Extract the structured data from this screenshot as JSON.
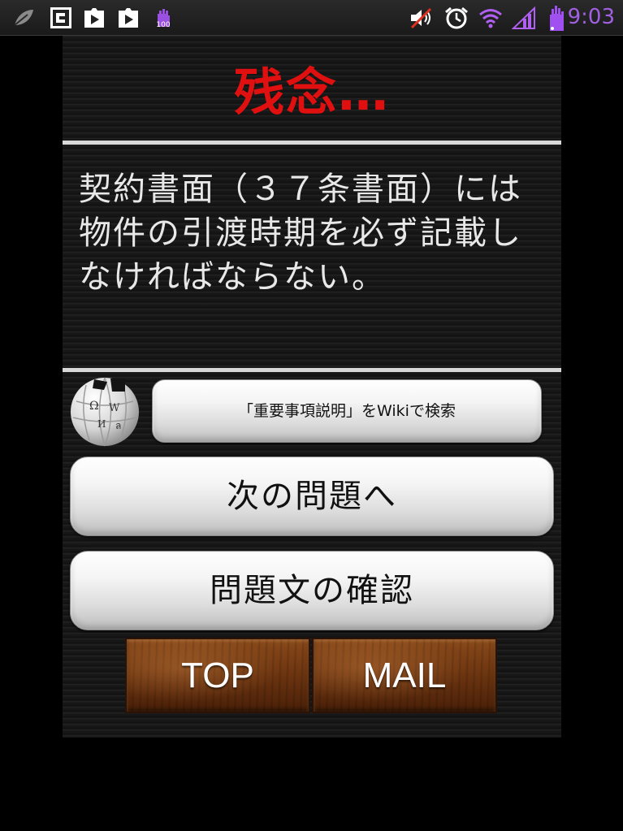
{
  "status_bar": {
    "time": "9:03",
    "notification_badge": "100",
    "icons": [
      "leaf-icon",
      "document-icon",
      "play-store-icon",
      "play-store-icon",
      "glove-100-icon",
      "mute-icon",
      "alarm-icon",
      "wifi-icon",
      "signal-icon",
      "glove-icon"
    ],
    "time_color": "#a060e0"
  },
  "result": {
    "title": "残念…",
    "title_color": "#e01010"
  },
  "question": {
    "text": "契約書面（３７条書面）には物件の引渡時期を必ず記載しなければならない。"
  },
  "wiki": {
    "icon": "wikipedia-globe-icon",
    "search_label": "「重要事項説明」をWikiで検索"
  },
  "actions": {
    "next_label": "次の問題へ",
    "review_label": "問題文の確認"
  },
  "footer": {
    "top_label": "TOP",
    "mail_label": "MAIL"
  }
}
